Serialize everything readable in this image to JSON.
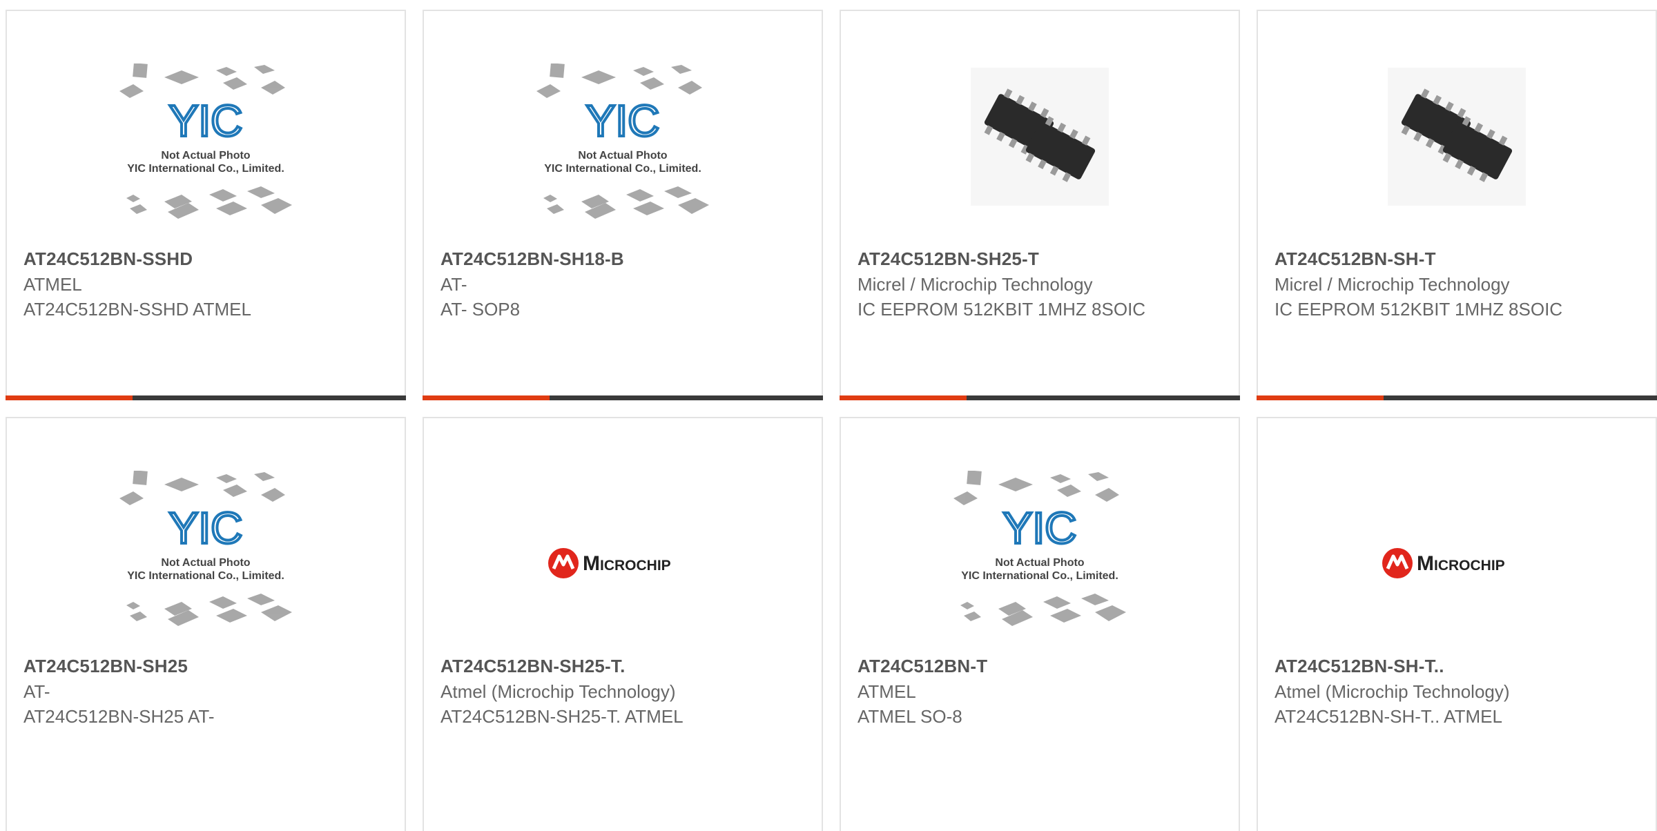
{
  "products": [
    {
      "title": "AT24C512BN-SSHD",
      "manufacturer": "ATMEL",
      "description": "AT24C512BN-SSHD ATMEL",
      "image": "placeholder"
    },
    {
      "title": "AT24C512BN-SH18-B",
      "manufacturer": "AT-",
      "description": "AT- SOP8",
      "image": "placeholder"
    },
    {
      "title": "AT24C512BN-SH25-T",
      "manufacturer": "Micrel / Microchip Technology",
      "description": "IC EEPROM 512KBIT 1MHZ 8SOIC",
      "image": "chip"
    },
    {
      "title": "AT24C512BN-SH-T",
      "manufacturer": "Micrel / Microchip Technology",
      "description": "IC EEPROM 512KBIT 1MHZ 8SOIC",
      "image": "chip"
    },
    {
      "title": "AT24C512BN-SH25",
      "manufacturer": "AT-",
      "description": "AT24C512BN-SH25 AT-",
      "image": "placeholder"
    },
    {
      "title": "AT24C512BN-SH25-T.",
      "manufacturer": "Atmel (Microchip Technology)",
      "description": "AT24C512BN-SH25-T. ATMEL",
      "image": "microchip-logo"
    },
    {
      "title": "AT24C512BN-T",
      "manufacturer": "ATMEL",
      "description": "ATMEL SO-8",
      "image": "placeholder"
    },
    {
      "title": "AT24C512BN-SH-T..",
      "manufacturer": "Atmel (Microchip Technology)",
      "description": "AT24C512BN-SH-T.. ATMEL",
      "image": "microchip-logo"
    }
  ],
  "placeholder": {
    "brand": "YIC",
    "line1": "Not Actual Photo",
    "line2": "YIC International Co., Limited."
  },
  "logo": {
    "text": "Microchip"
  },
  "colors": {
    "accent": "#e03c12",
    "bar": "#3a3a3a",
    "yic_blue": "#1f78b8",
    "microchip_red": "#e1261c"
  }
}
